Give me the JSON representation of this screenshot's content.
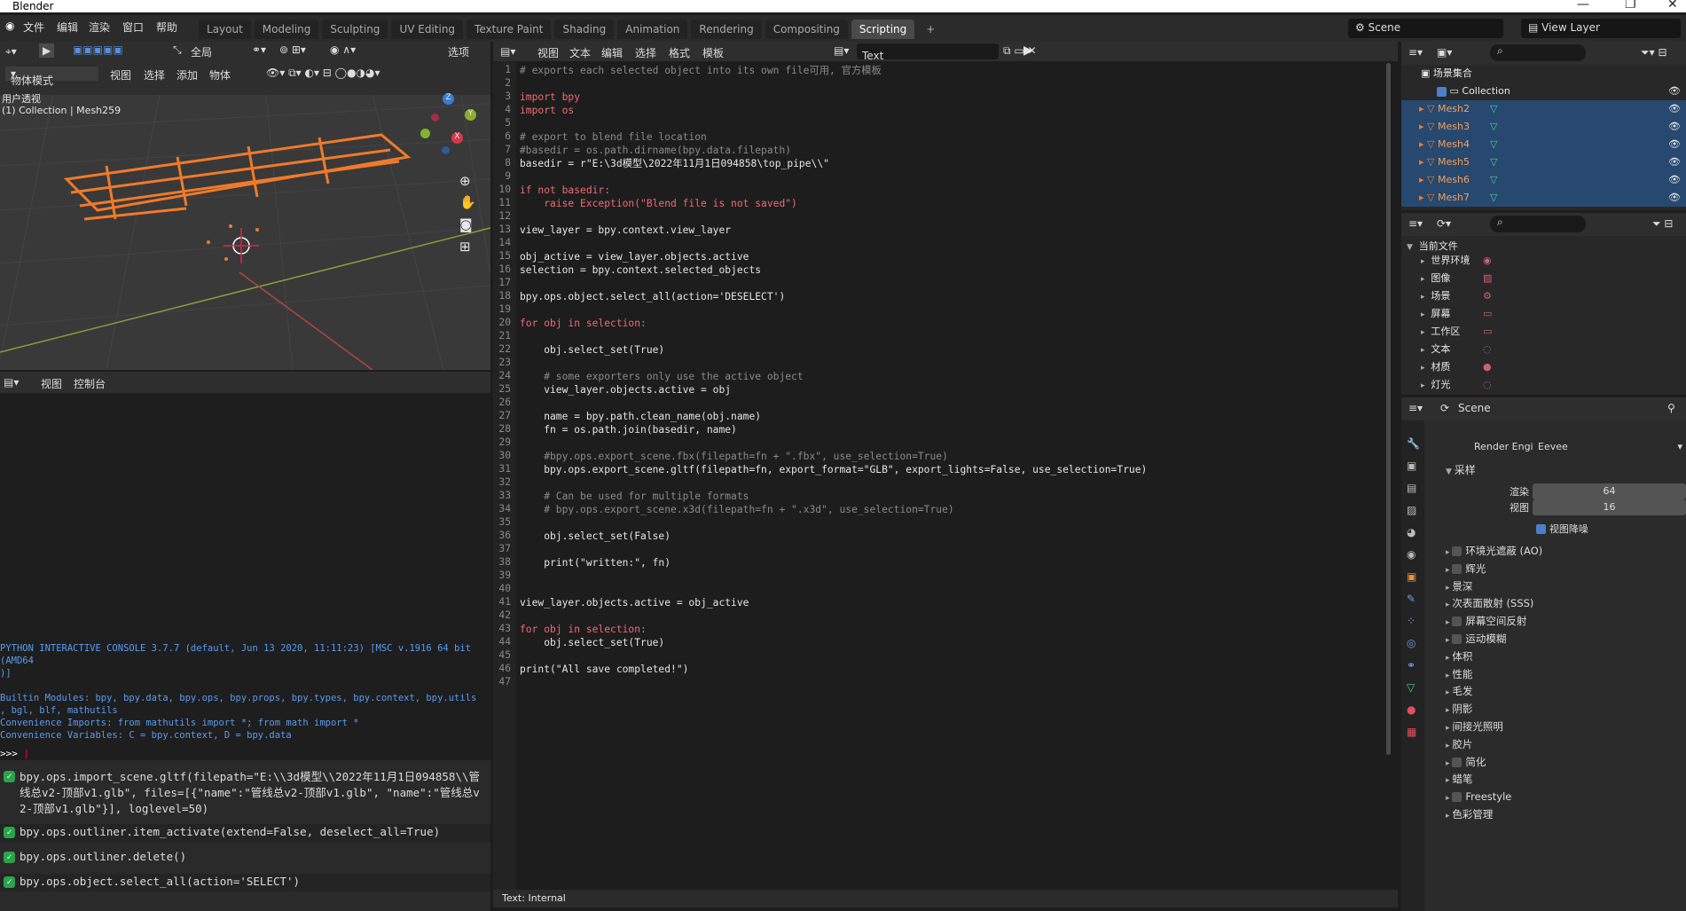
{
  "app": {
    "title": "Blender"
  },
  "menubar": {
    "items": [
      "文件",
      "编辑",
      "渲染",
      "窗口",
      "帮助"
    ]
  },
  "workspaces": {
    "tabs": [
      "Layout",
      "Modeling",
      "Sculpting",
      "UV Editing",
      "Texture Paint",
      "Shading",
      "Animation",
      "Rendering",
      "Compositing",
      "Scripting"
    ],
    "active": "Scripting"
  },
  "scene_selector": {
    "scene": "Scene",
    "view_layer": "View Layer"
  },
  "viewport": {
    "header_select": "全局",
    "header_options": "选项",
    "mode": "物体模式",
    "menu": [
      "视图",
      "选择",
      "添加",
      "物体"
    ],
    "overlay_title": "用户透视",
    "overlay_sub": "(1) Collection | Mesh259"
  },
  "console": {
    "menu": [
      "视图",
      "控制台"
    ],
    "banner": [
      "PYTHON INTERACTIVE CONSOLE 3.7.7 (default, Jun 13 2020, 11:11:23) [MSC v.1916 64 bit (AMD64",
      ")]",
      "",
      "Builtin Modules:       bpy, bpy.data, bpy.ops, bpy.props, bpy.types, bpy.context, bpy.utils",
      ", bgl, blf, mathutils",
      "Convenience Imports:   from mathutils import *; from math import *",
      "Convenience Variables: C = bpy.context, D = bpy.data"
    ],
    "prompt": ">>> "
  },
  "info": {
    "items": [
      "bpy.ops.import_scene.gltf(filepath=\"E:\\\\3d模型\\\\2022年11月1日094858\\\\管线总v2-顶部v1.glb\", files=[{\"name\":\"管线总v2-顶部v1.glb\", \"name\":\"管线总v2-顶部v1.glb\"}], loglevel=50)",
      "bpy.ops.outliner.item_activate(extend=False, deselect_all=True)",
      "bpy.ops.outliner.delete()",
      "bpy.ops.object.select_all(action='SELECT')"
    ]
  },
  "text_editor": {
    "menu": [
      "视图",
      "文本",
      "编辑",
      "选择",
      "格式",
      "模板"
    ],
    "datablock": "Text",
    "status": "Text: Internal",
    "lines": [
      "# exports each selected object into its own file可用, 官方模板",
      "",
      "import bpy",
      "import os",
      "",
      "# export to blend file location",
      "#basedir = os.path.dirname(bpy.data.filepath)",
      "basedir = r\"E:\\3d模型\\2022年11月1日094858\\top_pipe\\\\\"",
      "",
      "if not basedir:",
      "    raise Exception(\"Blend file is not saved\")",
      "",
      "view_layer = bpy.context.view_layer",
      "",
      "obj_active = view_layer.objects.active",
      "selection = bpy.context.selected_objects",
      "",
      "bpy.ops.object.select_all(action='DESELECT')",
      "",
      "for obj in selection:",
      "",
      "    obj.select_set(True)",
      "",
      "    # some exporters only use the active object",
      "    view_layer.objects.active = obj",
      "",
      "    name = bpy.path.clean_name(obj.name)",
      "    fn = os.path.join(basedir, name)",
      "",
      "    #bpy.ops.export_scene.fbx(filepath=fn + \".fbx\", use_selection=True)",
      "    bpy.ops.export_scene.gltf(filepath=fn, export_format=\"GLB\", export_lights=False, use_selection=True)",
      "",
      "    # Can be used for multiple formats",
      "    # bpy.ops.export_scene.x3d(filepath=fn + \".x3d\", use_selection=True)",
      "",
      "    obj.select_set(False)",
      "",
      "    print(\"written:\", fn)",
      "",
      "",
      "view_layer.objects.active = obj_active",
      "",
      "for obj in selection:",
      "    obj.select_set(True)",
      "",
      "print(\"All save completed!\")",
      ""
    ]
  },
  "outliner": {
    "root": "场景集合",
    "collection": "Collection",
    "items": [
      "Mesh2",
      "Mesh3",
      "Mesh4",
      "Mesh5",
      "Mesh6",
      "Mesh7"
    ]
  },
  "file_browser": {
    "root": "当前文件",
    "items": [
      "世界环境",
      "图像",
      "场景",
      "屏幕",
      "工作区",
      "文本",
      "材质",
      "灯光"
    ]
  },
  "properties": {
    "scene": "Scene",
    "render_engine_label": "Render Engine",
    "render_engine": "Eevee",
    "sampling": "采样",
    "render_label": "渲染",
    "render_value": "64",
    "viewport_label": "视图",
    "viewport_value": "16",
    "viewport_denoise": "视图降噪",
    "sections": [
      {
        "label": "环境光遮蔽 (AO)",
        "check": true
      },
      {
        "label": "辉光",
        "check": true
      },
      {
        "label": "景深",
        "check": false
      },
      {
        "label": "次表面散射 (SSS)",
        "check": false
      },
      {
        "label": "屏幕空间反射",
        "check": true
      },
      {
        "label": "运动模糊",
        "check": true
      },
      {
        "label": "体积",
        "check": false
      },
      {
        "label": "性能",
        "check": false
      },
      {
        "label": "毛发",
        "check": false
      },
      {
        "label": "阴影",
        "check": false
      },
      {
        "label": "间接光照明",
        "check": false
      },
      {
        "label": "胶片",
        "check": false
      },
      {
        "label": "简化",
        "check": true
      },
      {
        "label": "蜡笔",
        "check": false
      },
      {
        "label": "Freestyle",
        "check": true
      },
      {
        "label": "色彩管理",
        "check": false
      }
    ]
  },
  "colors": {
    "accent": "#4b7fc9",
    "selected_orange": "#f07a2a",
    "keyword": "#ef6b73",
    "string": "#f0d070",
    "comment": "#8a8a8a",
    "number": "#4fa4e8"
  }
}
